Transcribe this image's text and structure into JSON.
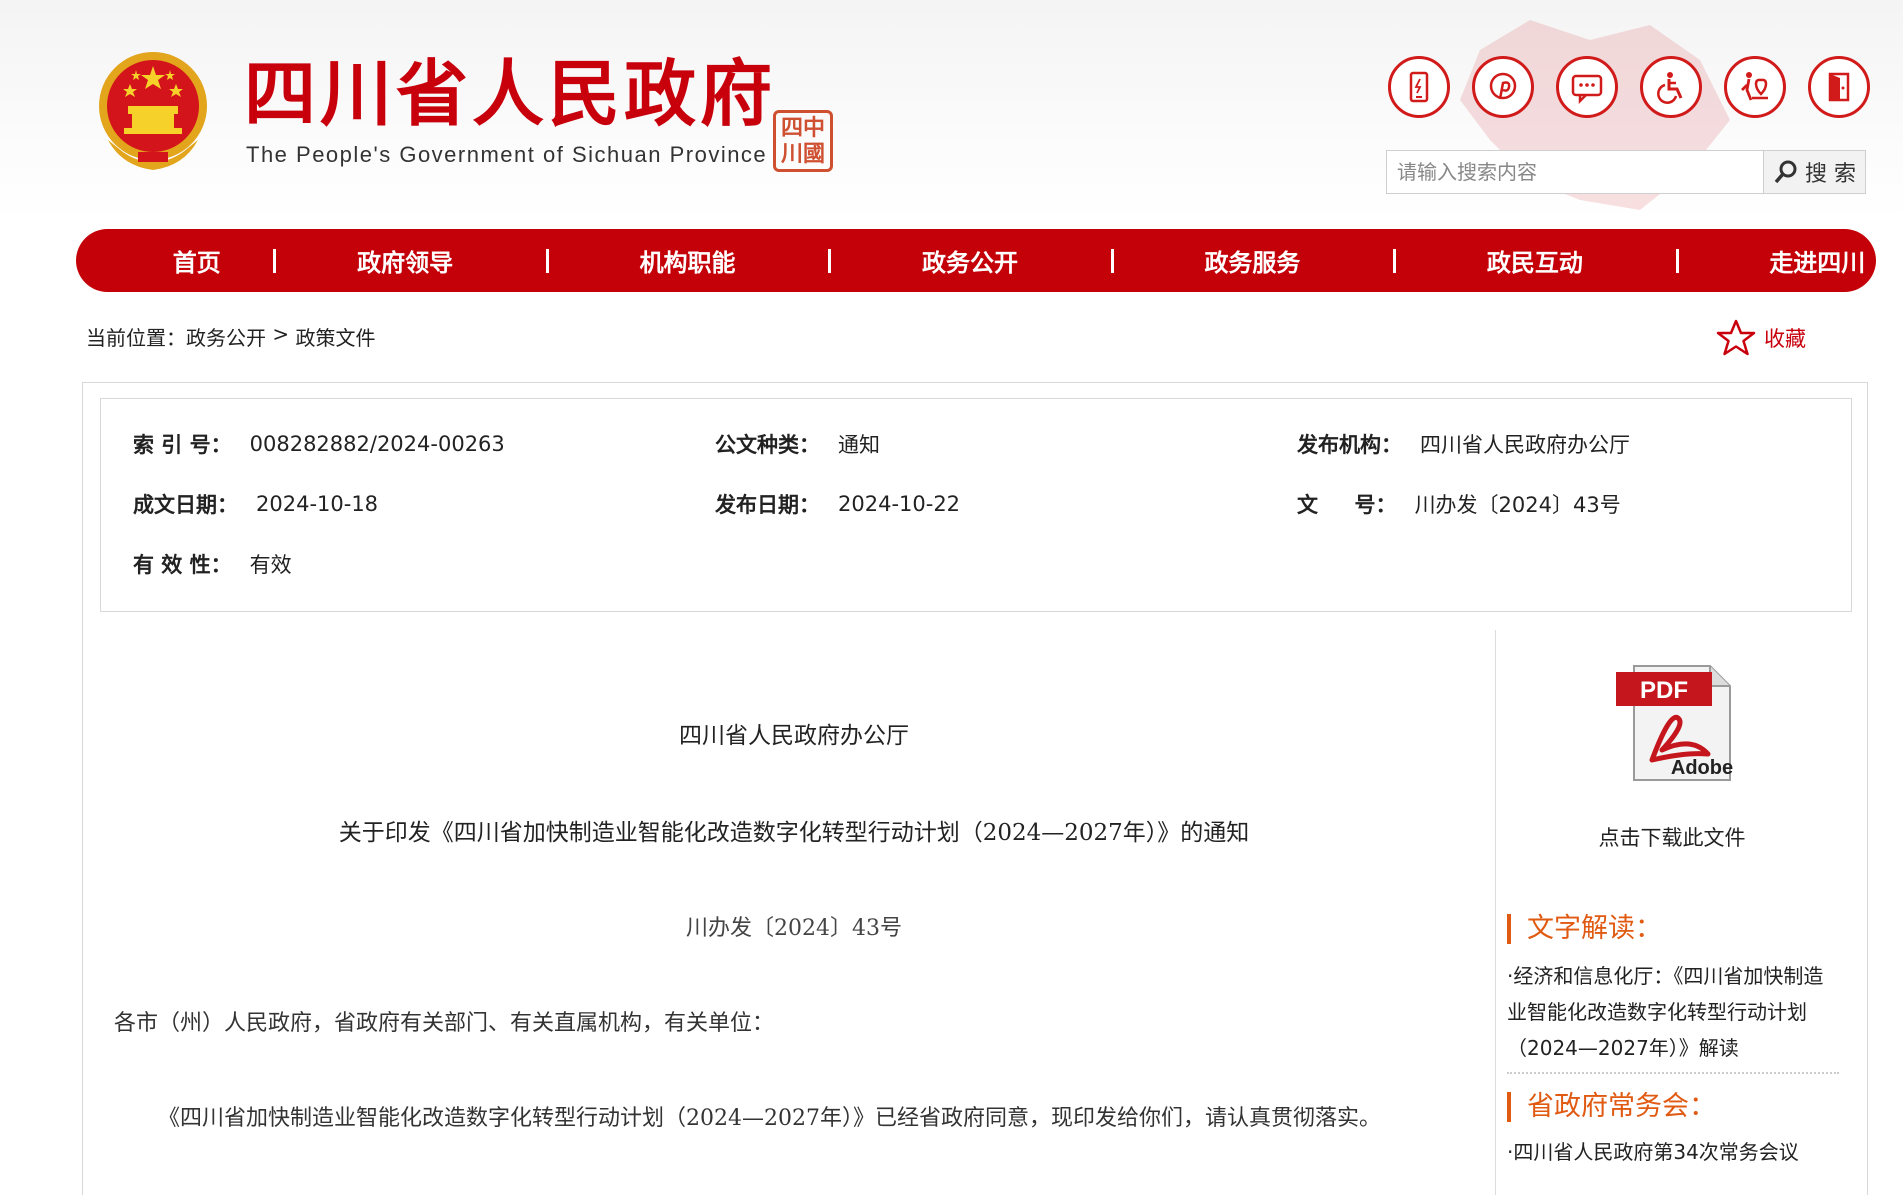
{
  "header": {
    "title": "四川省人民政府",
    "subtitle": "The People's Government of Sichuan Province",
    "seal_text": [
      "四",
      "中",
      "川",
      "國"
    ]
  },
  "tools": [
    {
      "name": "mobile-icon"
    },
    {
      "name": "pinterest-icon"
    },
    {
      "name": "message-icon"
    },
    {
      "name": "accessibility-icon"
    },
    {
      "name": "elderly-care-icon"
    },
    {
      "name": "exit-icon"
    }
  ],
  "search": {
    "placeholder": "请输入搜索内容",
    "button_label": "搜 索"
  },
  "nav": {
    "items": [
      "首页",
      "政府领导",
      "机构职能",
      "政务公开",
      "政务服务",
      "政民互动",
      "走进四川"
    ]
  },
  "breadcrumb": {
    "prefix": "当前位置：",
    "level1": "政务公开",
    "sep": " > ",
    "level2": "政策文件"
  },
  "favorite": {
    "label": "收藏"
  },
  "meta": {
    "index_label": "索 引 号：",
    "index_value": "008282882/2024-00263",
    "type_label": "公文种类：",
    "type_value": "通知",
    "publisher_label": "发布机构：",
    "publisher_value": "四川省人民政府办公厅",
    "created_label": "成文日期：",
    "created_value": "2024-10-18",
    "published_label": "发布日期：",
    "published_value": "2024-10-22",
    "docno_label": "文     号：",
    "docno_value": "川办发〔2024〕43号",
    "validity_label": "有 效 性：",
    "validity_value": "有效"
  },
  "document": {
    "issuer": "四川省人民政府办公厅",
    "title": "关于印发《四川省加快制造业智能化改造数字化转型行动计划（2024—2027年）》的通知",
    "number": "川办发〔2024〕43号",
    "recipient": "各市（州）人民政府，省政府有关部门、有关直属机构，有关单位：",
    "body": "《四川省加快制造业智能化改造数字化转型行动计划（2024—2027年）》已经省政府同意，现印发给你们，请认真贯彻落实。"
  },
  "sidebar": {
    "pdf_label_top": "PDF",
    "pdf_label_bottom": "Adobe",
    "download_label": "点击下载此文件",
    "interpret_heading": "文字解读：",
    "interpret_link": "·经济和信息化厅：《四川省加快制造业智能化改造数字化转型行动计划（2024—2027年）》解读",
    "meeting_heading": "省政府常务会：",
    "meeting_link": "·四川省人民政府第34次常务会议"
  },
  "colors": {
    "brand_red": "#c40008",
    "accent_orange": "#e05a12"
  }
}
